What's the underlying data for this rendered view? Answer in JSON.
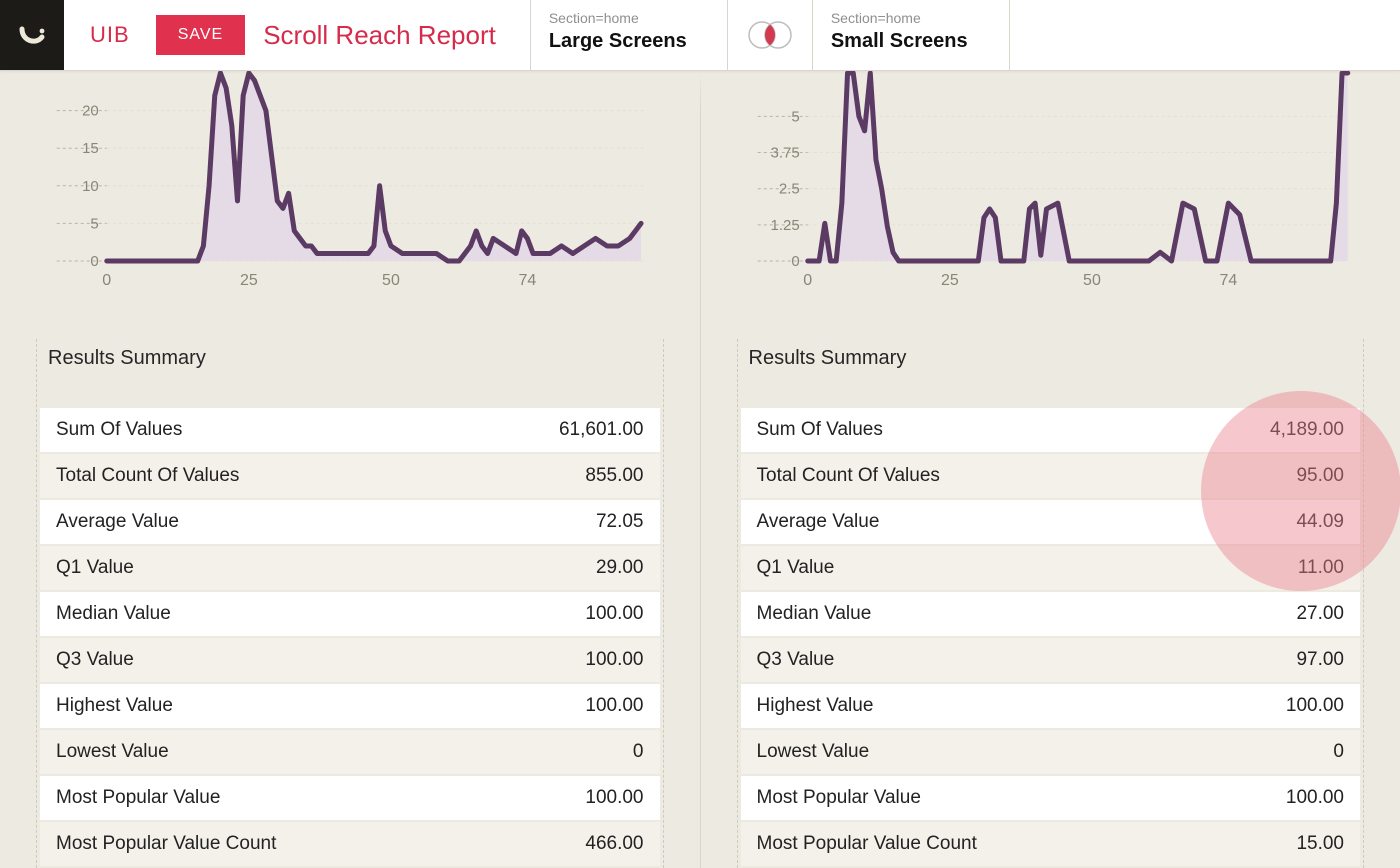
{
  "header": {
    "brand": "UIB",
    "save_label": "SAVE",
    "title": "Scroll Reach Report",
    "segment_left": {
      "label": "Section=home",
      "value": "Large Screens"
    },
    "segment_right": {
      "label": "Section=home",
      "value": "Small Screens"
    }
  },
  "summary_title": "Results Summary",
  "stat_labels": [
    "Sum Of Values",
    "Total Count Of Values",
    "Average Value",
    "Q1 Value",
    "Median Value",
    "Q3 Value",
    "Highest Value",
    "Lowest Value",
    "Most Popular Value",
    "Most Popular Value Count"
  ],
  "left": {
    "stats": [
      "61,601.00",
      "855.00",
      "72.05",
      "29.00",
      "100.00",
      "100.00",
      "100.00",
      "0",
      "100.00",
      "466.00"
    ]
  },
  "right": {
    "stats": [
      "4,189.00",
      "95.00",
      "44.09",
      "11.00",
      "27.00",
      "97.00",
      "100.00",
      "0",
      "100.00",
      "15.00"
    ]
  },
  "chart_data": [
    {
      "type": "line",
      "title": "",
      "xlabel": "",
      "ylabel": "",
      "xlim": [
        0,
        95
      ],
      "ylim": [
        0,
        25
      ],
      "y_ticks": [
        0,
        5,
        10,
        15,
        20
      ],
      "x_ticks": [
        0,
        25,
        50,
        74
      ],
      "x": [
        0,
        2,
        4,
        6,
        8,
        10,
        12,
        14,
        16,
        17,
        18,
        19,
        20,
        21,
        22,
        23,
        24,
        25,
        26,
        27,
        28,
        29,
        30,
        31,
        32,
        33,
        34,
        35,
        36,
        37,
        38,
        40,
        42,
        44,
        46,
        47,
        48,
        49,
        50,
        52,
        54,
        56,
        58,
        60,
        62,
        64,
        65,
        66,
        67,
        68,
        70,
        72,
        73,
        74,
        75,
        76,
        78,
        80,
        82,
        84,
        86,
        88,
        90,
        92,
        94
      ],
      "values": [
        0,
        0,
        0,
        0,
        0,
        0,
        0,
        0,
        0,
        2,
        10,
        22,
        25,
        23,
        18,
        8,
        22,
        25,
        24,
        22,
        20,
        14,
        8,
        7,
        9,
        4,
        3,
        2,
        2,
        1,
        1,
        1,
        1,
        1,
        1,
        2,
        10,
        4,
        2,
        1,
        1,
        1,
        1,
        0,
        0,
        2,
        4,
        2,
        1,
        3,
        2,
        1,
        4,
        3,
        1,
        1,
        1,
        2,
        1,
        2,
        3,
        2,
        2,
        3,
        5
      ],
      "stroke": "#5b3a63",
      "fill": "#e4dbe6"
    },
    {
      "type": "line",
      "title": "",
      "xlabel": "",
      "ylabel": "",
      "xlim": [
        0,
        95
      ],
      "ylim": [
        0,
        6.5
      ],
      "y_ticks": [
        0,
        1.25,
        2.5,
        3.75,
        5
      ],
      "x_ticks": [
        0,
        25,
        50,
        74
      ],
      "x": [
        0,
        1,
        2,
        3,
        4,
        5,
        6,
        7,
        8,
        9,
        10,
        11,
        12,
        13,
        14,
        15,
        16,
        17,
        18,
        20,
        22,
        24,
        26,
        28,
        30,
        31,
        32,
        33,
        34,
        36,
        38,
        39,
        40,
        41,
        42,
        44,
        46,
        48,
        50,
        52,
        54,
        56,
        58,
        60,
        62,
        64,
        66,
        68,
        70,
        72,
        74,
        76,
        78,
        80,
        82,
        84,
        86,
        88,
        90,
        92,
        93,
        94,
        95
      ],
      "values": [
        0,
        0,
        0,
        1.3,
        0,
        0,
        2,
        6.5,
        6.5,
        5,
        4.5,
        6.5,
        3.5,
        2.5,
        1.2,
        0.3,
        0,
        0,
        0,
        0,
        0,
        0,
        0,
        0,
        0,
        1.5,
        1.8,
        1.5,
        0,
        0,
        0,
        1.8,
        2,
        0.2,
        1.8,
        2,
        0,
        0,
        0,
        0,
        0,
        0,
        0,
        0,
        0.3,
        0,
        2,
        1.8,
        0,
        0,
        2,
        1.6,
        0,
        0,
        0,
        0,
        0,
        0,
        0,
        0,
        2,
        6.5,
        6.5
      ],
      "stroke": "#5b3a63",
      "fill": "#e4dbe6"
    }
  ]
}
